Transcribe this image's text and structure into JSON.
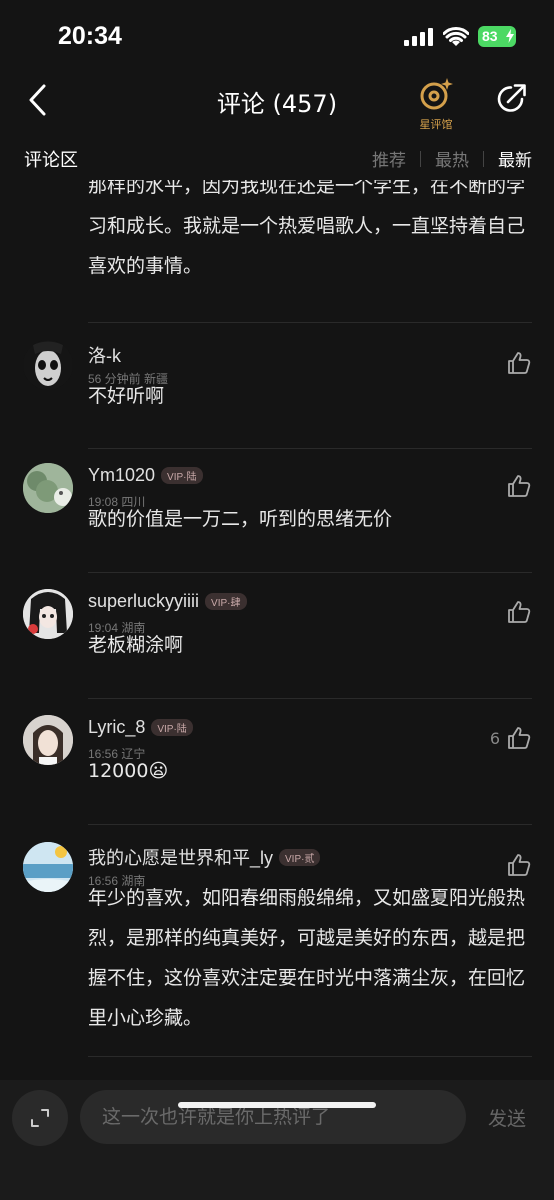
{
  "status": {
    "time": "20:34",
    "battery": "83"
  },
  "header": {
    "title": "评论 (457)",
    "review_hall_label": "星评馆"
  },
  "tabs": {
    "section_title": "评论区",
    "sort": [
      "推荐",
      "最热",
      "最新"
    ],
    "active": "最新"
  },
  "partial_comment": {
    "text": "那样的水平，因为我现在还是一个学生，在不断的学习和成长。我就是一个热爱唱歌人，一直坚持着自己喜欢的事情。"
  },
  "comments": [
    {
      "user": "洛-k",
      "vip": "",
      "meta": "56 分钟前 新疆",
      "text": "不好听啊",
      "likes": ""
    },
    {
      "user": "Ym1020",
      "vip": "VIP·陆",
      "meta": "19:08 四川",
      "text": "歌的价值是一万二，听到的思绪无价",
      "likes": ""
    },
    {
      "user": "superluckyyiiii",
      "vip": "VIP·肆",
      "meta": "19:04 湖南",
      "text": "老板糊涂啊",
      "likes": ""
    },
    {
      "user": "Lyric_8",
      "vip": "VIP·陆",
      "meta": "16:56 辽宁",
      "text": "12000",
      "emoji": "😦",
      "likes": "6"
    },
    {
      "user": "我的心愿是世界和平_ly",
      "vip": "VIP·贰",
      "meta": "16:56 湖南",
      "text": "年少的喜欢，如阳春细雨般绵绵，又如盛夏阳光般热烈，是那样的纯真美好，可越是美好的东西，越是把握不住，这份喜欢注定要在时光中落满尘灰，在回忆里小心珍藏。",
      "likes": ""
    }
  ],
  "input": {
    "placeholder": "这一次也许就是你上热评了",
    "send_label": "发送"
  },
  "colors": {
    "background": "#141414",
    "accent_gold": "#d4a04b",
    "battery_green": "#4cd964"
  }
}
